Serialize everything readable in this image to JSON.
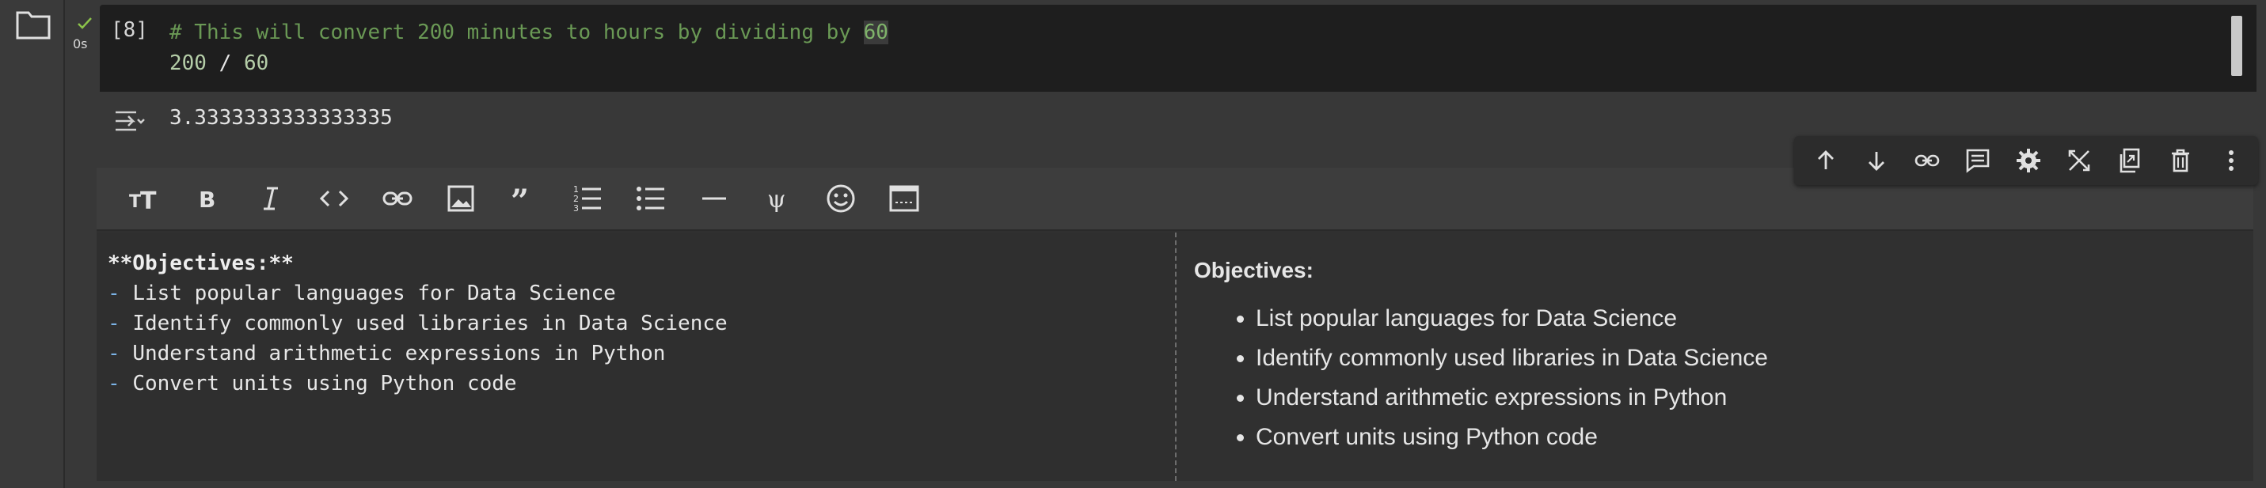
{
  "sidebar": {
    "folder_icon": "folder-icon"
  },
  "code_cell": {
    "status_icon": "check-icon",
    "run_time": "0s",
    "execution_count": "[8]",
    "comment_prefix": "# This will convert 200 minutes to hours by dividing by ",
    "comment_number": "60",
    "expr_left": "200",
    "expr_op": " / ",
    "expr_right": "60"
  },
  "output": {
    "icon": "output-toggle-icon",
    "value": "3.3333333333333335"
  },
  "cell_toolbar": {
    "buttons": [
      "move-up-icon",
      "move-down-icon",
      "link-icon",
      "comment-icon",
      "settings-icon",
      "mirror-cell-icon",
      "copy-to-tab-icon",
      "delete-icon",
      "more-icon"
    ]
  },
  "markdown_toolbar": {
    "buttons": [
      "heading-icon",
      "bold-icon",
      "italic-icon",
      "code-icon",
      "link-icon",
      "image-icon",
      "quote-icon",
      "numbered-list-icon",
      "bulleted-list-icon",
      "horizontal-rule-icon",
      "latex-icon",
      "emoji-icon",
      "preview-layout-icon"
    ]
  },
  "markdown_source": {
    "heading": "**Objectives:**",
    "dash": "-",
    "items": [
      "List popular languages for Data Science",
      "Identify commonly used libraries in Data Science",
      "Understand arithmetic expressions in Python",
      "Convert units using Python code"
    ]
  },
  "markdown_preview": {
    "heading": "Objectives:",
    "items": [
      "List popular languages for Data Science",
      "Identify commonly used libraries in Data Science",
      "Understand arithmetic expressions in Python",
      "Convert units using Python code"
    ]
  },
  "colors": {
    "comment": "#6a9955",
    "number": "#b5cea8",
    "background": "#383838",
    "code_bg": "#1e1e1e"
  }
}
